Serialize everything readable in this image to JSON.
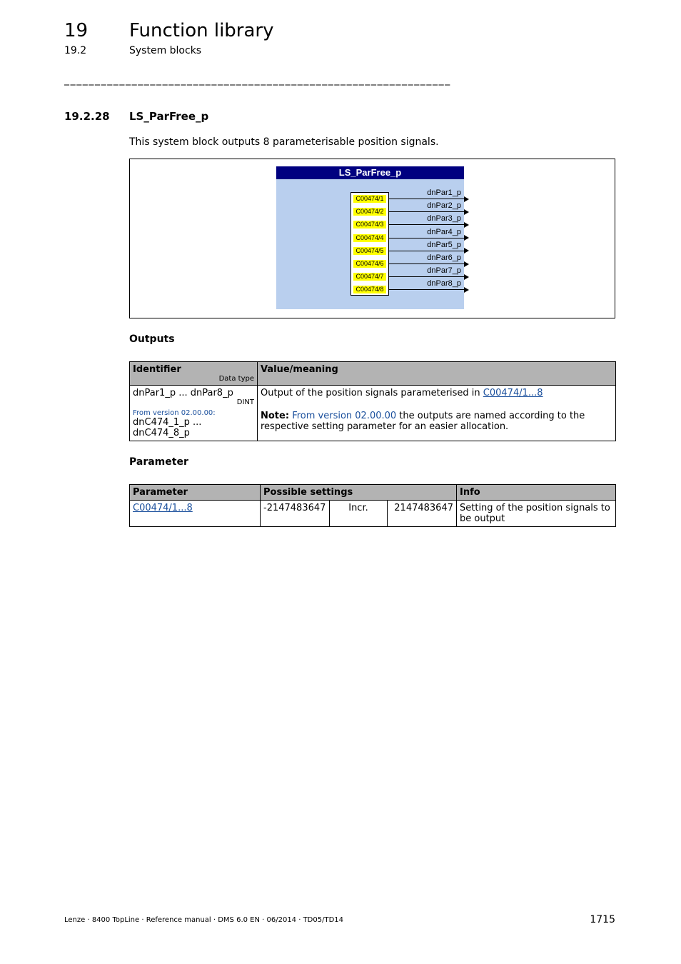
{
  "header": {
    "chapter_number": "19",
    "chapter_title": "Function library",
    "section_number": "19.2",
    "section_title": "System blocks",
    "divider": "_______________________________________________________________"
  },
  "subsection": {
    "number": "19.2.28",
    "title": "LS_ParFree_p",
    "intro": "This system block outputs 8 parameterisable position signals."
  },
  "diagram": {
    "block_title": "LS_ParFree_p",
    "colors": {
      "title_bg": "#000080",
      "body_bg": "#b9cfee",
      "tag_bg": "#ffff00"
    },
    "params": [
      "C00474/1",
      "C00474/2",
      "C00474/3",
      "C00474/4",
      "C00474/5",
      "C00474/6",
      "C00474/7",
      "C00474/8"
    ],
    "outputs": [
      "dnPar1_p",
      "dnPar2_p",
      "dnPar3_p",
      "dnPar4_p",
      "dnPar5_p",
      "dnPar6_p",
      "dnPar7_p",
      "dnPar8_p"
    ]
  },
  "outputs_section": {
    "heading": "Outputs",
    "headers": {
      "identifier": "Identifier",
      "data_type": "Data type",
      "value": "Value/meaning"
    },
    "row": {
      "identifier": "dnPar1_p ... dnPar8_p",
      "data_type": "DINT",
      "version_note": "From version 02.00.00:",
      "identifier_new": "dnC474_1_p ... dnC474_8_p",
      "meaning_prefix": "Output of the position signals parameterised in ",
      "meaning_link": "C00474/1...8",
      "note_label": "Note:",
      "note_link": "From version 02.00.00",
      "note_text": " the outputs are named according to the respective setting parameter for an easier allocation."
    }
  },
  "parameter_section": {
    "heading": "Parameter",
    "headers": {
      "parameter": "Parameter",
      "possible": "Possible settings",
      "info": "Info"
    },
    "row": {
      "parameter": "C00474/1...8",
      "min": "-2147483647",
      "incr": "Incr.",
      "max": "2147483647",
      "info": "Setting of the position signals to be output"
    }
  },
  "footer": {
    "left": "Lenze · 8400 TopLine · Reference manual · DMS 6.0 EN · 06/2014 · TD05/TD14",
    "page": "1715"
  }
}
